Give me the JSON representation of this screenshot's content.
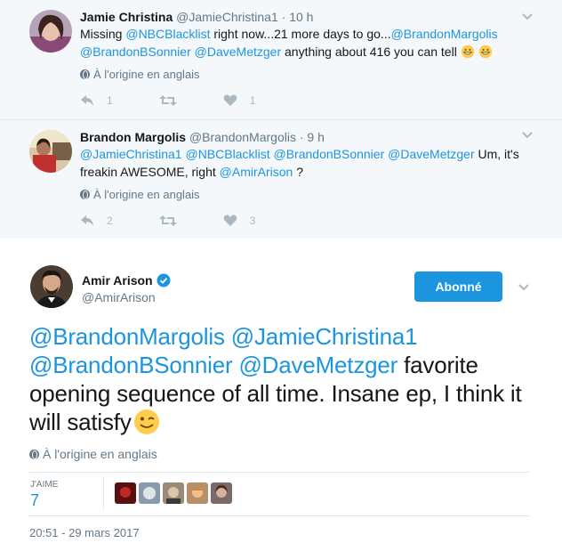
{
  "replies": [
    {
      "name": "Jamie Christina",
      "handle": "@JamieChristina1",
      "dot": "·",
      "time": "10 h",
      "text_parts": {
        "p1": "Missing ",
        "m1": "@NBCBlacklist",
        "p2": " right now...21 more days to go...",
        "m2": "@BrandonMargolis",
        "m3": "@BrandonBSonnier",
        "p3": " ",
        "m4": "@DaveMetzger",
        "p4": " anything about 416 you can tell "
      },
      "translation": "À l'origine en anglais",
      "reply_count": "1",
      "retweet_count": "",
      "like_count": "1"
    },
    {
      "name": "Brandon Margolis",
      "handle": "@BrandonMargolis",
      "dot": "·",
      "time": "9 h",
      "text_parts": {
        "m1": "@JamieChristina1",
        "p1": " ",
        "m2": "@NBCBlacklist",
        "p2": " ",
        "m3": "@BrandonBSonnier",
        "p3": " ",
        "m4": "@DaveMetzger",
        "p4": " Um, it's freakin AWESOME, right ",
        "m5": "@AmirArison",
        "p5": " ?"
      },
      "translation": "À l'origine en anglais",
      "reply_count": "2",
      "retweet_count": "",
      "like_count": "3"
    }
  ],
  "main": {
    "name": "Amir Arison",
    "handle": "@AmirArison",
    "follow_label": "Abonné",
    "text_parts": {
      "m1": "@BrandonMargolis",
      "p1": " ",
      "m2": "@JamieChristina1",
      "m3": "@BrandonBSonnier",
      "p2": " ",
      "m4": "@DaveMetzger",
      "p3": " favorite opening sequence of all time.  Insane ep, I think it will satisfy"
    },
    "translation": "À l'origine en anglais",
    "likes_label": "J'aime",
    "likes_count": "7",
    "timestamp": "20:51 - 29 mars 2017"
  },
  "icons": {
    "reply": "reply-icon",
    "retweet": "retweet-icon",
    "like": "heart-icon",
    "more": "chevron-down-icon",
    "verified": "verified-badge-icon",
    "globe": "globe-icon",
    "emoji_grin": "grinning-emoji",
    "emoji_wink": "winking-emoji"
  },
  "colors": {
    "link": "#1b95e0",
    "secondary_text": "#657786",
    "reply_bg": "#f5f8fa",
    "follow_button": "#1b95e0"
  }
}
